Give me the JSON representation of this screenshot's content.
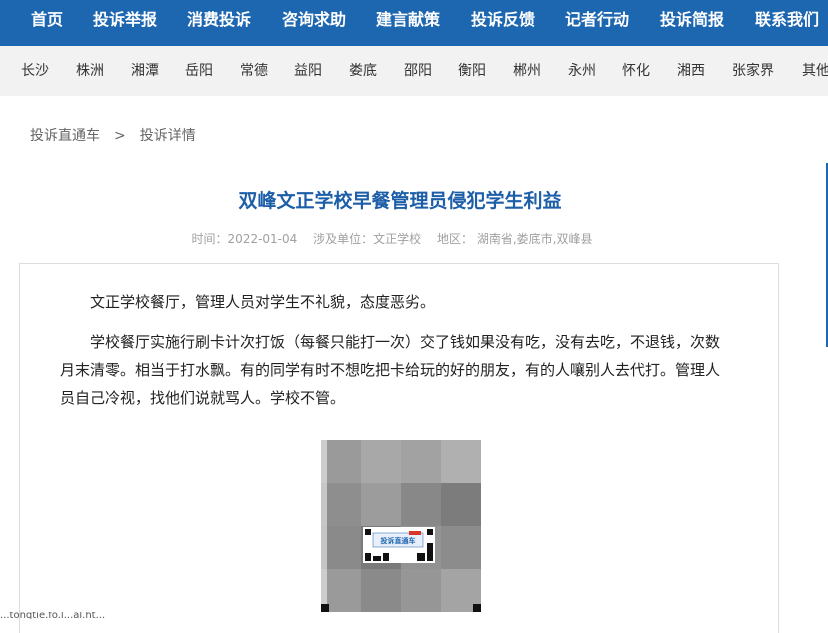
{
  "topnav": {
    "items": [
      "首页",
      "投诉举报",
      "消费投诉",
      "咨询求助",
      "建言献策",
      "投诉反馈",
      "记者行动",
      "投诉简报",
      "联系我们"
    ]
  },
  "citynav": {
    "items": [
      "长沙",
      "株洲",
      "湘潭",
      "岳阳",
      "常德",
      "益阳",
      "娄底",
      "邵阳",
      "衡阳",
      "郴州",
      "永州",
      "怀化",
      "湘西",
      "张家界",
      "其他"
    ]
  },
  "breadcrumb": {
    "home": "投诉直通车",
    "sep": ">",
    "current": "投诉详情"
  },
  "article": {
    "title": "双峰文正学校早餐管理员侵犯学生利益",
    "time_label": "时间：",
    "time": "2022-01-04",
    "unit_label": "涉及单位：",
    "unit": "文正学校",
    "region_label": "地区：",
    "region": "湖南省,娄底市,双峰县",
    "paragraphs": [
      "文正学校餐厅，管理人员对学生不礼貌，态度恶劣。",
      "学校餐厅实施行刷卡计次打饭（每餐只能打一次）交了钱如果没有吃，没有去吃，不退钱，次数月末清零。相当于打水飘。有的同学有时不想吃把卡给玩的好的朋友，有的人嚷别人去代打。管理人员自己冷视，找他们说就骂人。学校不管。"
    ],
    "qr_logo_text": "投诉直通车"
  },
  "status": {
    "url_fragment": "...tonqtie.fo.l...al.ht..."
  }
}
